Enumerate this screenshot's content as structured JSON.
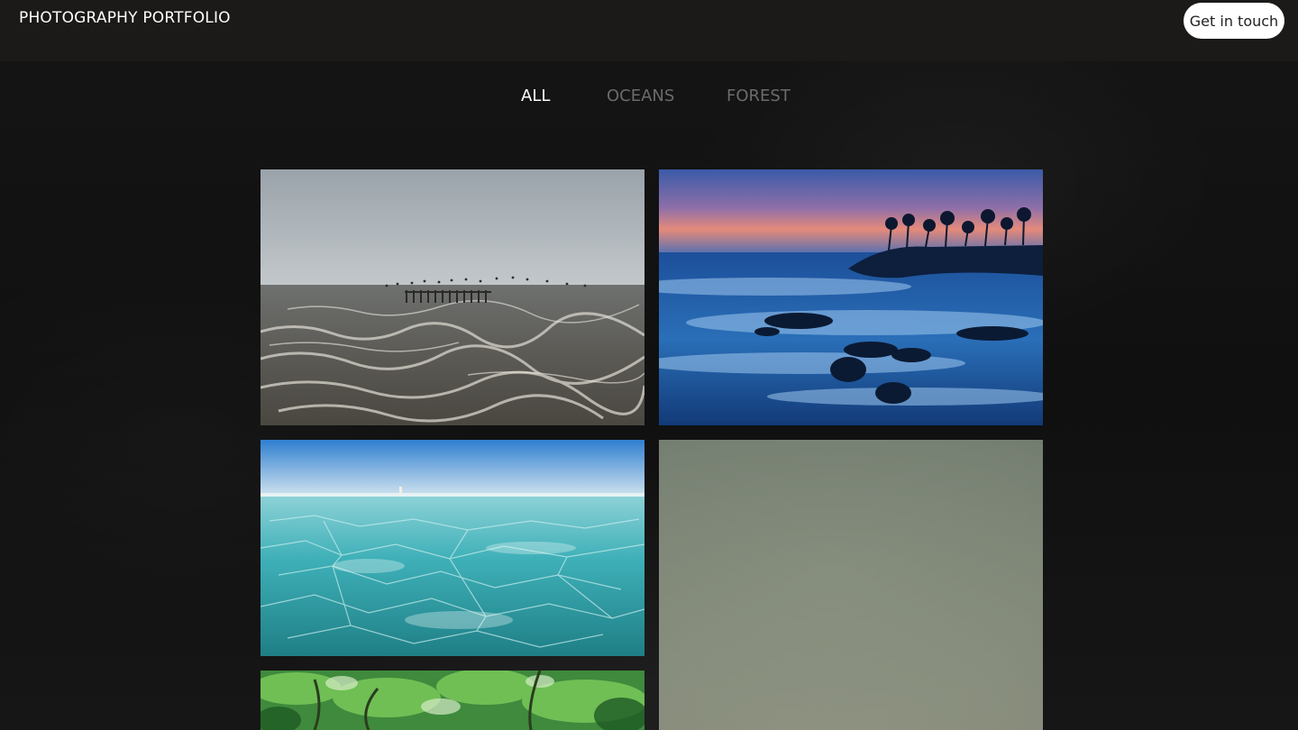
{
  "header": {
    "brand": "PHOTOGRAPHY PORTFOLIO",
    "cta_label": "Get in touch"
  },
  "filters": {
    "items": [
      {
        "label": "ALL",
        "active": true
      },
      {
        "label": "OCEANS",
        "active": false
      },
      {
        "label": "FOREST",
        "active": false
      }
    ]
  },
  "gallery": {
    "photos": [
      {
        "subject": "stormy grey sea with old pier and birds",
        "category": "oceans"
      },
      {
        "subject": "blue long-exposure coast at sunset with palm trees",
        "category": "oceans"
      },
      {
        "subject": "turquoise icy water under blue sky",
        "category": "oceans"
      },
      {
        "subject": "misty grey-green blurred scene",
        "category": "forest"
      },
      {
        "subject": "green tree canopy",
        "category": "forest"
      }
    ]
  },
  "colors": {
    "header_bg": "#1b1a18",
    "page_bg": "#121212",
    "active_filter": "#ffffff",
    "inactive_filter": "#6b6b6b"
  }
}
